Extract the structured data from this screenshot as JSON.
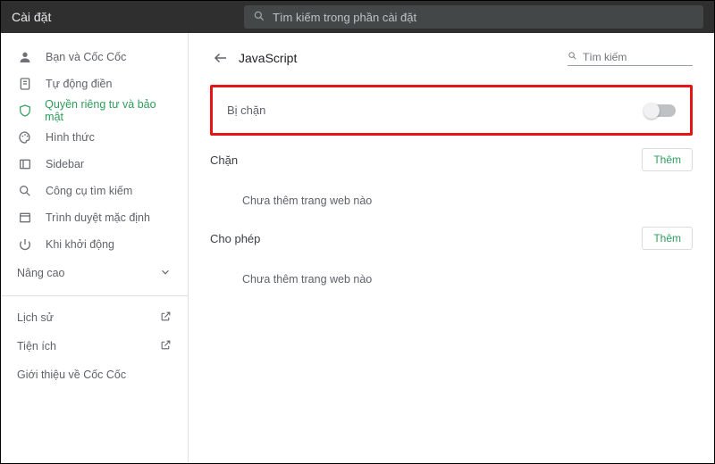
{
  "header": {
    "title": "Cài đặt",
    "search_placeholder": "Tìm kiếm trong phần cài đặt"
  },
  "sidebar": {
    "items": [
      {
        "label": "Bạn và Cốc Cốc",
        "icon": "person"
      },
      {
        "label": "Tự động điền",
        "icon": "autofill"
      },
      {
        "label": "Quyền riêng tư và bảo mật",
        "icon": "shield",
        "active": true
      },
      {
        "label": "Hình thức",
        "icon": "palette"
      },
      {
        "label": "Sidebar",
        "icon": "sidebar"
      },
      {
        "label": "Công cụ tìm kiếm",
        "icon": "search"
      },
      {
        "label": "Trình duyệt mặc định",
        "icon": "browser"
      },
      {
        "label": "Khi khởi động",
        "icon": "power"
      }
    ],
    "advanced_label": "Nâng cao",
    "links": [
      {
        "label": "Lịch sử"
      },
      {
        "label": "Tiện ích"
      }
    ],
    "about_label": "Giới thiệu về Cốc Cốc"
  },
  "page": {
    "title": "JavaScript",
    "search_placeholder": "Tìm kiếm",
    "blocked_label": "Bị chặn",
    "blocked_toggle": false,
    "block_section_title": "Chặn",
    "block_add_label": "Thêm",
    "block_empty_text": "Chưa thêm trang web nào",
    "allow_section_title": "Cho phép",
    "allow_add_label": "Thêm",
    "allow_empty_text": "Chưa thêm trang web nào"
  }
}
